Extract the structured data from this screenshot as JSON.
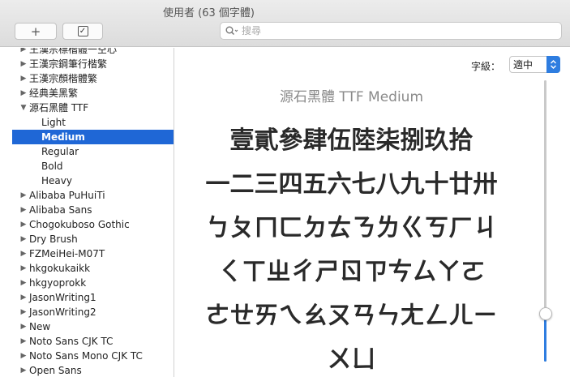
{
  "window": {
    "title": "使用者 (63 個字體)"
  },
  "toolbar": {
    "add_label": "+",
    "check_label": "✓"
  },
  "search": {
    "placeholder": "搜尋",
    "value": ""
  },
  "sidebar": {
    "items": [
      {
        "label": "王漢宗標楷體一空心",
        "expanded": false,
        "child": false,
        "selected": false
      },
      {
        "label": "王漢宗鋼筆行楷繁",
        "expanded": false,
        "child": false,
        "selected": false
      },
      {
        "label": "王漢宗顏楷體繁",
        "expanded": false,
        "child": false,
        "selected": false
      },
      {
        "label": "经典美黑繁",
        "expanded": false,
        "child": false,
        "selected": false
      },
      {
        "label": "源石黑體 TTF",
        "expanded": true,
        "child": false,
        "selected": false
      },
      {
        "label": "Light",
        "expanded": false,
        "child": true,
        "selected": false
      },
      {
        "label": "Medium",
        "expanded": false,
        "child": true,
        "selected": true
      },
      {
        "label": "Regular",
        "expanded": false,
        "child": true,
        "selected": false
      },
      {
        "label": "Bold",
        "expanded": false,
        "child": true,
        "selected": false
      },
      {
        "label": "Heavy",
        "expanded": false,
        "child": true,
        "selected": false
      },
      {
        "label": "Alibaba PuHuiTi",
        "expanded": false,
        "child": false,
        "selected": false
      },
      {
        "label": "Alibaba Sans",
        "expanded": false,
        "child": false,
        "selected": false
      },
      {
        "label": "Chogokuboso Gothic",
        "expanded": false,
        "child": false,
        "selected": false
      },
      {
        "label": "Dry Brush",
        "expanded": false,
        "child": false,
        "selected": false
      },
      {
        "label": "FZMeiHei-M07T",
        "expanded": false,
        "child": false,
        "selected": false
      },
      {
        "label": "hkgokukaikk",
        "expanded": false,
        "child": false,
        "selected": false
      },
      {
        "label": "hkgyoprokk",
        "expanded": false,
        "child": false,
        "selected": false
      },
      {
        "label": "JasonWriting1",
        "expanded": false,
        "child": false,
        "selected": false
      },
      {
        "label": "JasonWriting2",
        "expanded": false,
        "child": false,
        "selected": false
      },
      {
        "label": "New",
        "expanded": false,
        "child": false,
        "selected": false
      },
      {
        "label": "Noto Sans CJK TC",
        "expanded": false,
        "child": false,
        "selected": false
      },
      {
        "label": "Noto Sans Mono CJK TC",
        "expanded": false,
        "child": false,
        "selected": false
      },
      {
        "label": "Open Sans",
        "expanded": false,
        "child": false,
        "selected": false
      }
    ]
  },
  "preview": {
    "size_label": "字級：",
    "size_value": "適中",
    "font_name": "源石黑體 TTF Medium",
    "sample_lines": [
      "壹貳參肆伍陸柒捌玖拾",
      "一二三四五六七八九十廿卅",
      "ㄅㄆㄇㄈㄉㄊㄋㄌㄍㄎㄏㄐ",
      "ㄑㄒㄓㄔㄕㄖㄗㄘㄙㄚㄛ",
      "ㄜㄝㄞㄟㄠㄡㄢㄣㄤㄥㄦㄧ",
      "ㄨㄩ"
    ]
  },
  "colors": {
    "accent": "#2e7de0",
    "selection": "#1f67d6"
  },
  "icons": {
    "add": "plus-icon",
    "check": "checkbox-icon",
    "search": "magnifier-icon",
    "disclosure_closed": "triangle-right-icon",
    "disclosure_open": "triangle-down-icon",
    "select_arrows": "chevron-updown-icon"
  }
}
